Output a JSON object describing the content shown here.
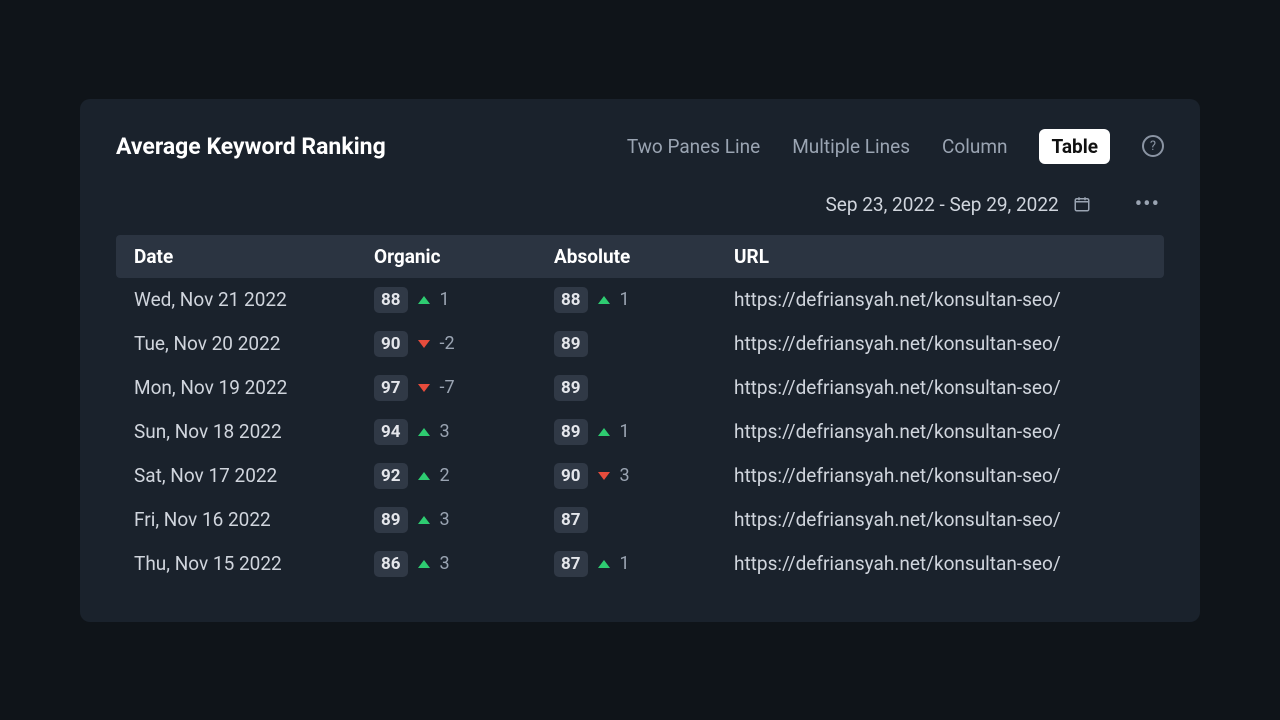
{
  "title": "Average Keyword Ranking",
  "tabs": [
    {
      "label": "Two Panes Line",
      "active": false
    },
    {
      "label": "Multiple Lines",
      "active": false
    },
    {
      "label": "Column",
      "active": false
    },
    {
      "label": "Table",
      "active": true
    }
  ],
  "date_range": "Sep 23, 2022 - Sep 29, 2022",
  "columns": {
    "c0": "Date",
    "c1": "Organic",
    "c2": "Absolute",
    "c3": "URL"
  },
  "rows": [
    {
      "date": "Wed, Nov 21 2022",
      "organic": {
        "value": "88",
        "delta": "1",
        "dir": "up"
      },
      "absolute": {
        "value": "88",
        "delta": "1",
        "dir": "up"
      },
      "url": "https://defriansyah.net/konsultan-seo/"
    },
    {
      "date": "Tue, Nov 20 2022",
      "organic": {
        "value": "90",
        "delta": "-2",
        "dir": "down"
      },
      "absolute": {
        "value": "89",
        "delta": "",
        "dir": "none"
      },
      "url": "https://defriansyah.net/konsultan-seo/"
    },
    {
      "date": "Mon, Nov 19 2022",
      "organic": {
        "value": "97",
        "delta": "-7",
        "dir": "down"
      },
      "absolute": {
        "value": "89",
        "delta": "",
        "dir": "none"
      },
      "url": "https://defriansyah.net/konsultan-seo/"
    },
    {
      "date": "Sun, Nov 18 2022",
      "organic": {
        "value": "94",
        "delta": "3",
        "dir": "up"
      },
      "absolute": {
        "value": "89",
        "delta": "1",
        "dir": "up"
      },
      "url": "https://defriansyah.net/konsultan-seo/"
    },
    {
      "date": "Sat, Nov 17 2022",
      "organic": {
        "value": "92",
        "delta": "2",
        "dir": "up"
      },
      "absolute": {
        "value": "90",
        "delta": "3",
        "dir": "down"
      },
      "url": "https://defriansyah.net/konsultan-seo/"
    },
    {
      "date": "Fri, Nov 16 2022",
      "organic": {
        "value": "89",
        "delta": "3",
        "dir": "up"
      },
      "absolute": {
        "value": "87",
        "delta": "",
        "dir": "none"
      },
      "url": "https://defriansyah.net/konsultan-seo/"
    },
    {
      "date": "Thu, Nov 15 2022",
      "organic": {
        "value": "86",
        "delta": "3",
        "dir": "up"
      },
      "absolute": {
        "value": "87",
        "delta": "1",
        "dir": "up"
      },
      "url": "https://defriansyah.net/konsultan-seo/"
    }
  ]
}
